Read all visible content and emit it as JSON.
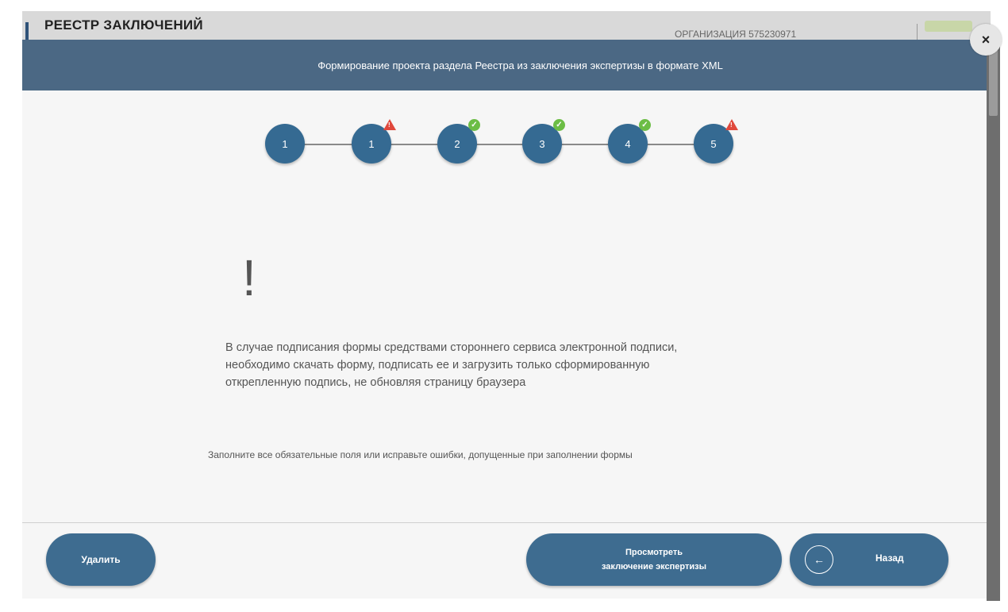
{
  "background": {
    "title": "РЕЕСТР ЗАКЛЮЧЕНИЙ",
    "org": "ОРГАНИЗАЦИЯ 575230971"
  },
  "modal": {
    "title": "Формирование проекта раздела Реестра из заключения экспертизы в формате XML",
    "close_label": "×",
    "steps": [
      {
        "label": "1",
        "status": "none"
      },
      {
        "label": "1",
        "status": "warning"
      },
      {
        "label": "2",
        "status": "ok"
      },
      {
        "label": "3",
        "status": "ok"
      },
      {
        "label": "4",
        "status": "ok"
      },
      {
        "label": "5",
        "status": "warning"
      }
    ],
    "alert_symbol": "!",
    "warning_text": "В случае подписания формы средствами стороннего сервиса электронной подписи, необходимо скачать форму, подписать ее и загрузить только сформированную открепленную подпись, не обновляя страницу браузера",
    "fill_note": "Заполните все обязательные поля или исправьте ошибки, допущенные при заполнении формы",
    "buttons": {
      "delete": "Удалить",
      "view_line1": "Просмотреть",
      "view_line2": "заключение экспертизы",
      "back": "Назад"
    }
  },
  "colors": {
    "header": "#4b6884",
    "button": "#3e6c90",
    "step": "#356a92",
    "ok": "#6cbd45",
    "warning": "#e0483c"
  }
}
